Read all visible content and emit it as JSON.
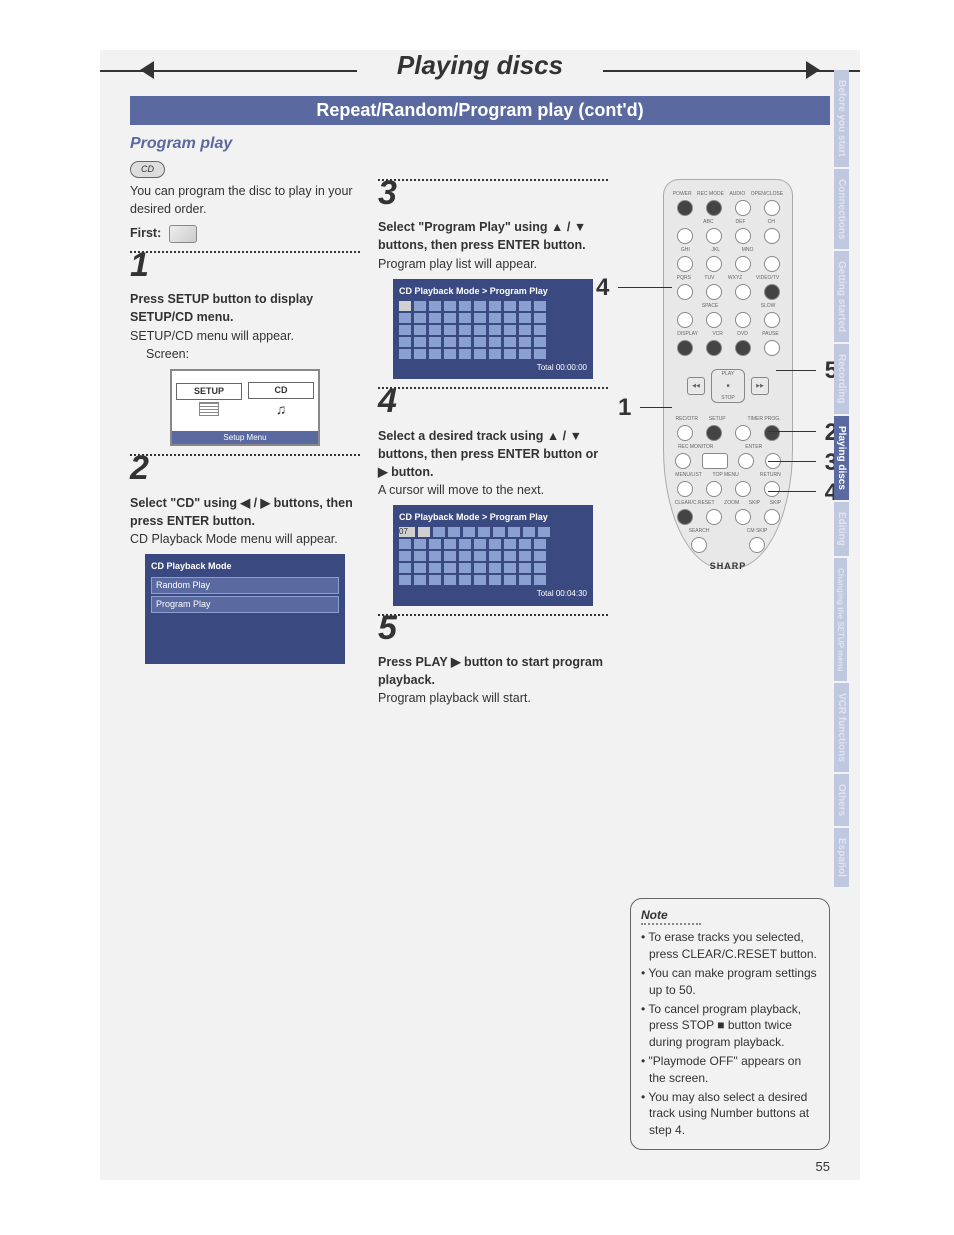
{
  "page": {
    "title": "Playing discs",
    "subtitle": "Repeat/Random/Program play (cont'd)",
    "section": "Program play",
    "number": "55",
    "cd_badge": "CD"
  },
  "intro": {
    "text": "You can program the disc to play in your desired order.",
    "first_label": "First:"
  },
  "steps": {
    "s1": {
      "num": "1",
      "head": "Press SETUP button to display SETUP/CD menu.",
      "body": "SETUP/CD menu will appear.",
      "screen_label": "Screen:",
      "box_setup": "SETUP",
      "box_cd": "CD",
      "box_foot": "Setup Menu"
    },
    "s2": {
      "num": "2",
      "head": "Select \"CD\" using ◀ / ▶ buttons, then press ENTER button.",
      "body": "CD Playback Mode menu will appear.",
      "menu_title": "CD Playback Mode",
      "menu_items": [
        "Random Play",
        "Program Play"
      ]
    },
    "s3": {
      "num": "3",
      "head": "Select \"Program Play\" using ▲ / ▼ buttons, then press ENTER button.",
      "body": "Program play list will appear.",
      "box_title": "CD Playback Mode > Program Play",
      "total": "Total     00:00:00"
    },
    "s4": {
      "num": "4",
      "head": "Select a desired track using ▲ / ▼ buttons, then press ENTER button or ▶ button.",
      "body": "A cursor will move to the next.",
      "box_title": "CD Playback Mode > Program Play",
      "first_val": "07",
      "total": "Total     00:04:30"
    },
    "s5": {
      "num": "5",
      "head": "Press PLAY ▶ button to start program playback.",
      "body": "Program playback will start."
    }
  },
  "remote": {
    "brand": "SHARP",
    "row1": [
      "POWER",
      "REC MODE",
      "AUDIO",
      "OPEN/CLOSE"
    ],
    "row2": [
      "ABC",
      "DEF",
      "CH"
    ],
    "row3": [
      "GHI",
      "JKL",
      "MNO"
    ],
    "row4": [
      "PQRS",
      "TUV",
      "WXYZ",
      "VIDEO/TV"
    ],
    "row5": [
      "SPACE",
      "SLOW"
    ],
    "row6": [
      "DISPLAY",
      "VCR",
      "DVD",
      "PAUSE"
    ],
    "cross": {
      "up": "PLAY",
      "down": "STOP",
      "left": "◀◀",
      "right": "▶▶"
    },
    "row7": [
      "REC/OTR",
      "SETUP",
      "",
      "TIMER PROG."
    ],
    "row8": [
      "REC MONITOR",
      "",
      "ENTER",
      ""
    ],
    "row9": [
      "MENU/LIST",
      "TOP MENU",
      "",
      "RETURN"
    ],
    "row10": [
      "CLEAR/C.RESET",
      "ZOOM",
      "SKIP",
      "SKIP"
    ],
    "row11": [
      "SEARCH",
      "CM SKIP"
    ]
  },
  "callouts": {
    "c1": "1",
    "c2": "2",
    "c3": "3",
    "c4": "4",
    "c4b": "4",
    "c5": "5"
  },
  "note": {
    "title": "Note",
    "items": [
      "• To erase tracks you selected, press CLEAR/C.RESET button.",
      "• You can make program settings up to 50.",
      "• To cancel program playback, press STOP ■ button twice during program playback.",
      "• \"Playmode OFF\" appears on the screen.",
      "• You may also select a desired track using Number buttons at step 4."
    ]
  },
  "tabs": [
    {
      "label": "Before you start",
      "active": false
    },
    {
      "label": "Connections",
      "active": false
    },
    {
      "label": "Getting started",
      "active": false
    },
    {
      "label": "Recording",
      "active": false
    },
    {
      "label": "Playing discs",
      "active": true
    },
    {
      "label": "Editing",
      "active": false
    },
    {
      "label": "Changing the SETUP menu",
      "active": false
    },
    {
      "label": "VCR functions",
      "active": false
    },
    {
      "label": "Others",
      "active": false
    },
    {
      "label": "Español",
      "active": false
    }
  ]
}
